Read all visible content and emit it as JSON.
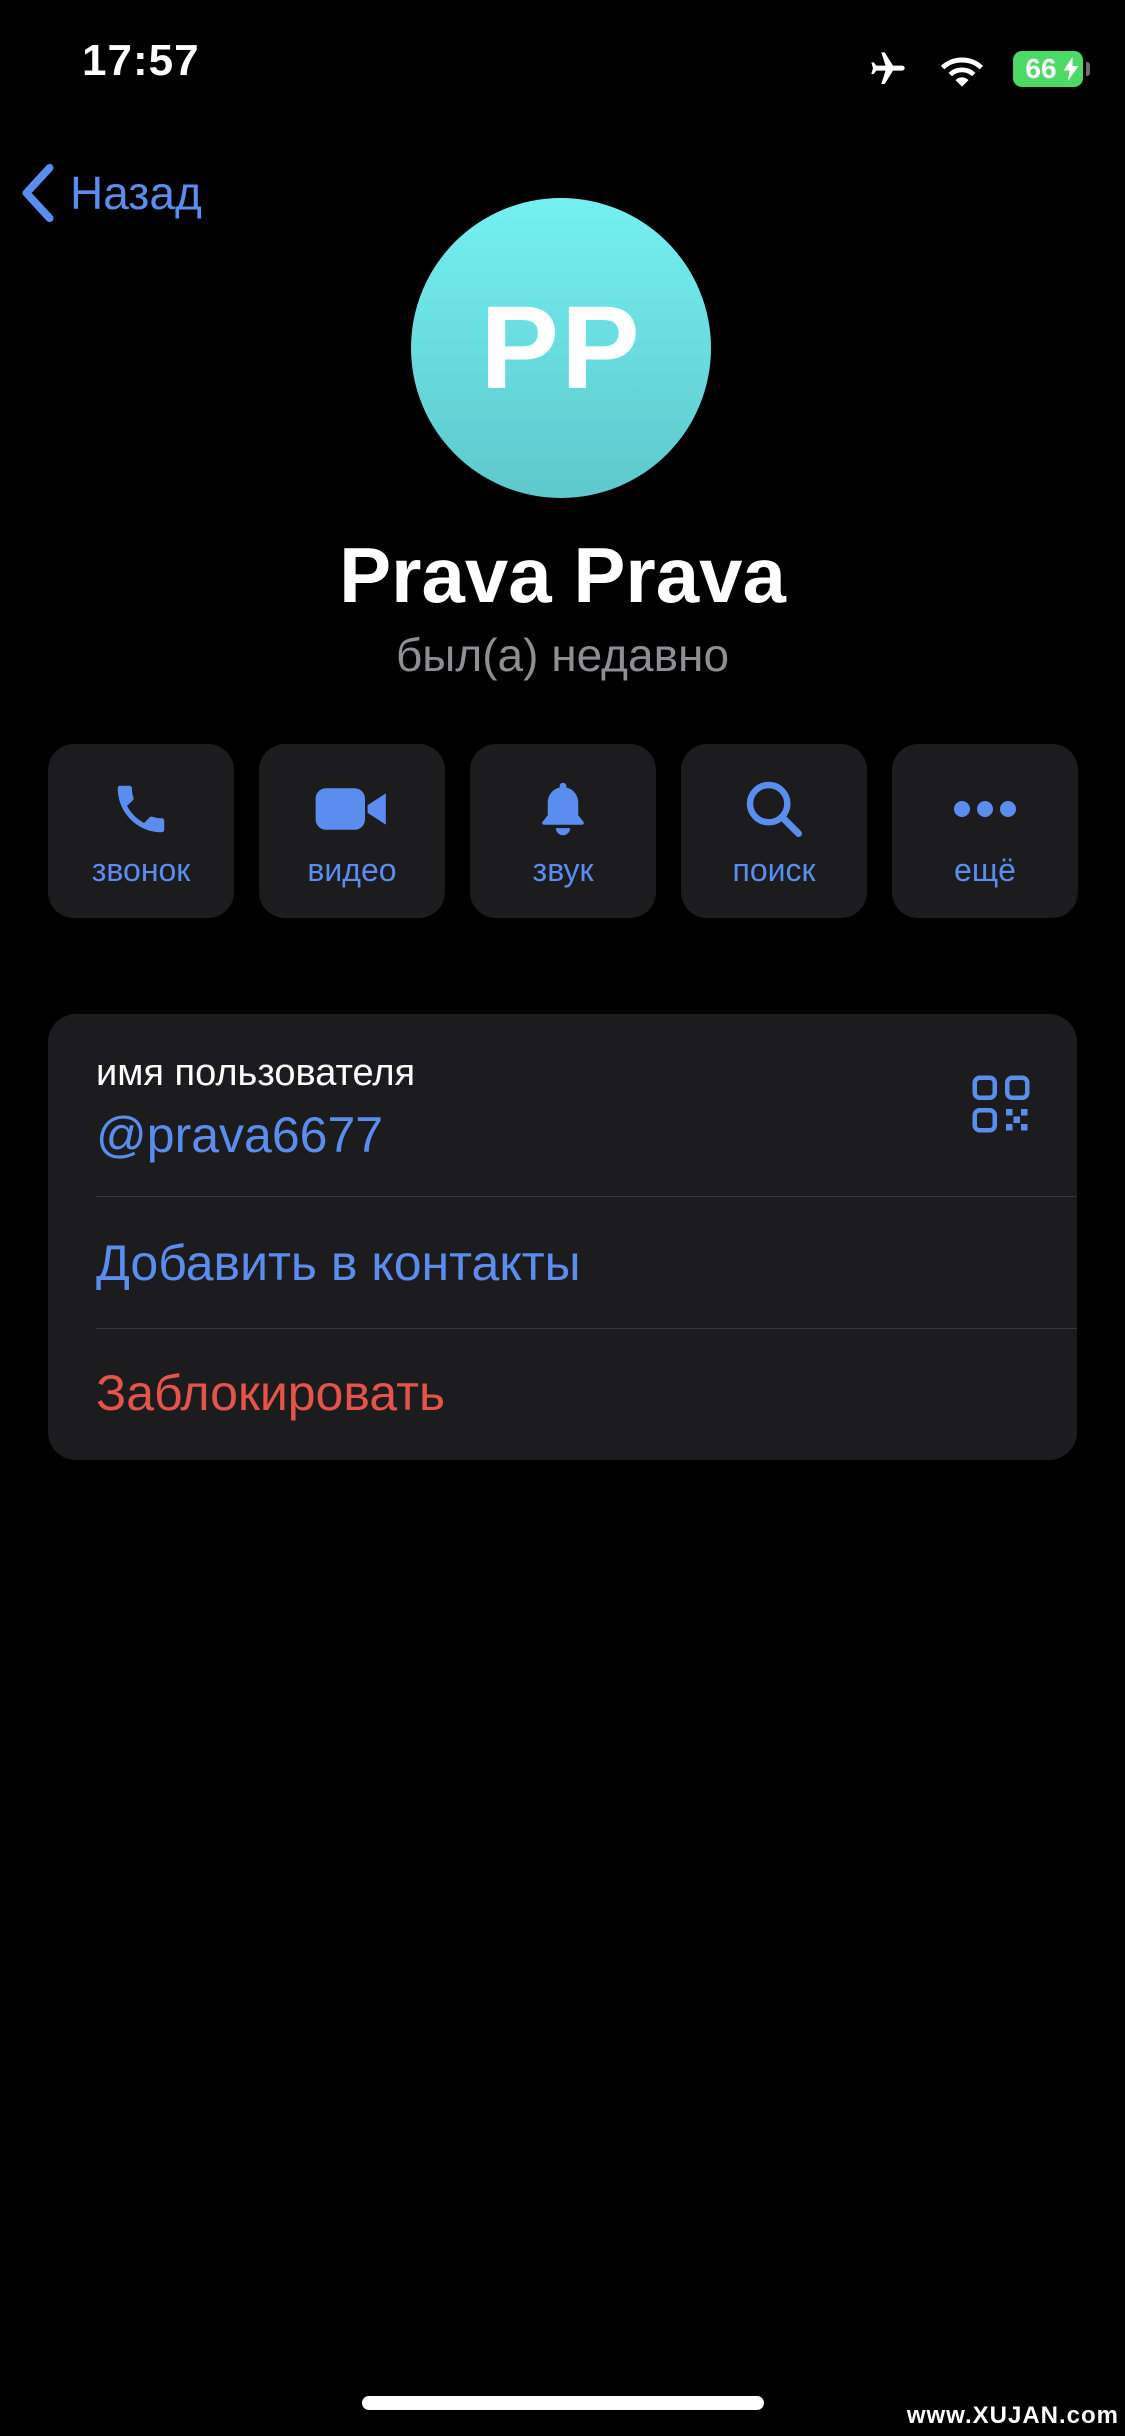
{
  "status_bar": {
    "time": "17:57",
    "battery_percent": "66",
    "icons": [
      "airplane-icon",
      "wifi-icon",
      "battery-charging-icon"
    ]
  },
  "nav": {
    "back_label": "Назад"
  },
  "profile": {
    "initials": "PP",
    "name": "Prava Prava",
    "presence": "был(а) недавно",
    "avatar_gradient": [
      "#74f0f1",
      "#5ec8cc"
    ]
  },
  "actions": [
    {
      "label": "звонок",
      "icon": "phone-icon"
    },
    {
      "label": "видео",
      "icon": "video-icon"
    },
    {
      "label": "звук",
      "icon": "bell-icon"
    },
    {
      "label": "поиск",
      "icon": "search-icon"
    },
    {
      "label": "ещё",
      "icon": "more-icon"
    }
  ],
  "info": {
    "username_label": "имя пользователя",
    "username_value": "@prava6677",
    "add_contact": "Добавить в контакты",
    "block": "Заблокировать"
  },
  "watermark": "www.XUJAN.com",
  "colors": {
    "accent": "#5b8def",
    "danger": "#e5544b",
    "card": "#1c1c1e",
    "background": "#000000"
  }
}
